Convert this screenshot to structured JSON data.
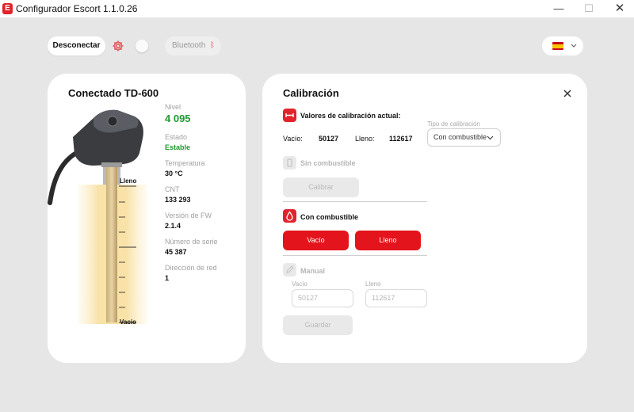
{
  "window": {
    "title": "Configurador Escort 1.1.0.26",
    "logo_letter": "E",
    "minimize": "—",
    "maximize": "☐",
    "close": "✕"
  },
  "toolbar": {
    "disconnect_label": "Desconectar",
    "bluetooth_label": "Bluetooth",
    "language": "es",
    "accent_color": "#e0242b"
  },
  "device": {
    "title": "Conectado  TD-600",
    "scale_top": "Lleno",
    "scale_bottom": "Vacío",
    "info": [
      {
        "label": "Nivel",
        "value": "4 095"
      },
      {
        "label": "Estado",
        "value": "Estable"
      },
      {
        "label": "Temperatura",
        "value": "30 °C"
      },
      {
        "label": "CNT",
        "value": "133 293"
      },
      {
        "label": "Versión de FW",
        "value": "2.1.4"
      },
      {
        "label": "Número de serie",
        "value": "45 387"
      },
      {
        "label": "Dirección de red",
        "value": "1"
      }
    ]
  },
  "calibration": {
    "title": "Calibración",
    "current": {
      "title": "Valores de calibración actual:",
      "vacio_label": "Vacío:",
      "vacio_value": "50127",
      "lleno_label": "Lleno:",
      "lleno_value": "112617"
    },
    "type": {
      "label": "Tipo de calibración",
      "selected": "Con combustible"
    },
    "sin_combustible": {
      "title": "Sin combustible",
      "button": "Calibrar"
    },
    "con_combustible": {
      "title": "Con combustible",
      "vacio_button": "Vacío",
      "lleno_button": "Lleno"
    },
    "manual": {
      "title": "Manual",
      "vacio_label": "Vacío",
      "vacio_placeholder": "50127",
      "lleno_label": "Lleno",
      "lleno_placeholder": "112617",
      "save_button": "Guardar"
    }
  }
}
